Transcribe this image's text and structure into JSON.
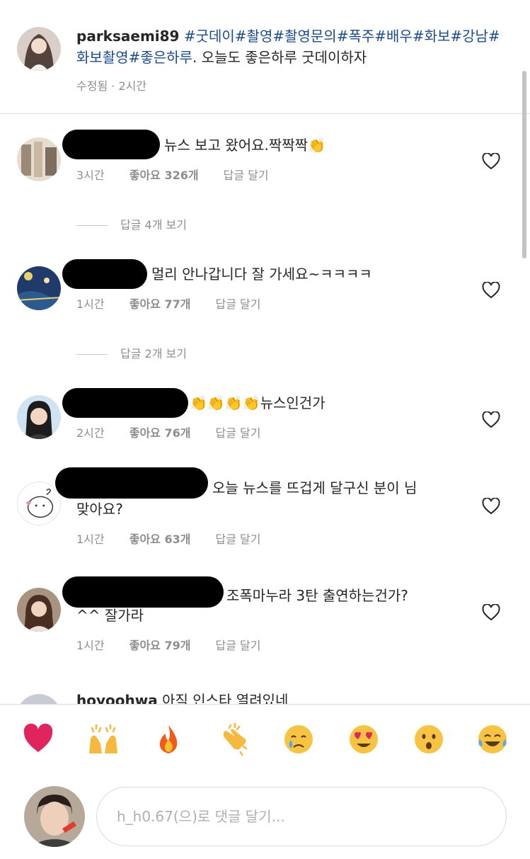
{
  "post": {
    "username": "parksaemi89",
    "hashtags": "#굿데이#촬영#촬영문의#폭주#배우#화보#강남#화보촬영#좋은하루",
    "text": ".  오늘도 좋은하루 굿데이하자",
    "edited_label": "수정됨",
    "separator": "·",
    "time": "2시간"
  },
  "comments": [
    {
      "text": "뉴스 보고 왔어요.짝짝짝👏",
      "time": "3시간",
      "likes": "좋아요 326개",
      "reply": "답글 달기",
      "view_replies": "답글 4개 보기"
    },
    {
      "text": "멀리 안나갑니다 잘 가세요~ㅋㅋㅋㅋ",
      "time": "1시간",
      "likes": "좋아요 77개",
      "reply": "답글 달기",
      "view_replies": "답글 2개 보기"
    },
    {
      "text": "👏👏👏👏뉴스인건가",
      "time": "2시간",
      "likes": "좋아요 76개",
      "reply": "답글 달기"
    },
    {
      "text_line1": "오늘 뉴스를 뜨겁게 달구신 분이 님",
      "text_line2": "맞아요?",
      "time": "1시간",
      "likes": "좋아요 63개",
      "reply": "답글 달기"
    },
    {
      "text_line1": "조폭마누라 3탄 출연하는건가?",
      "text_line2": "^^ 잘가라",
      "time": "1시간",
      "likes": "좋아요 79개",
      "reply": "답글 달기"
    },
    {
      "username": "hoyoohwa",
      "text": "아직 인스타 열려있네"
    }
  ],
  "emoji_bar": [
    "heart",
    "raising-hands",
    "fire",
    "clapping-hands",
    "crying-face",
    "heart-eyes",
    "surprised-face",
    "tears-of-joy"
  ],
  "comment_input": {
    "placeholder": "h_h0.67(으)로 댓글 달기..."
  },
  "colors": {
    "hashtag": "#1b4b8a",
    "meta": "#8e8e8e",
    "divider": "#dbdbdb",
    "heart_emoji": "#e0245e"
  }
}
